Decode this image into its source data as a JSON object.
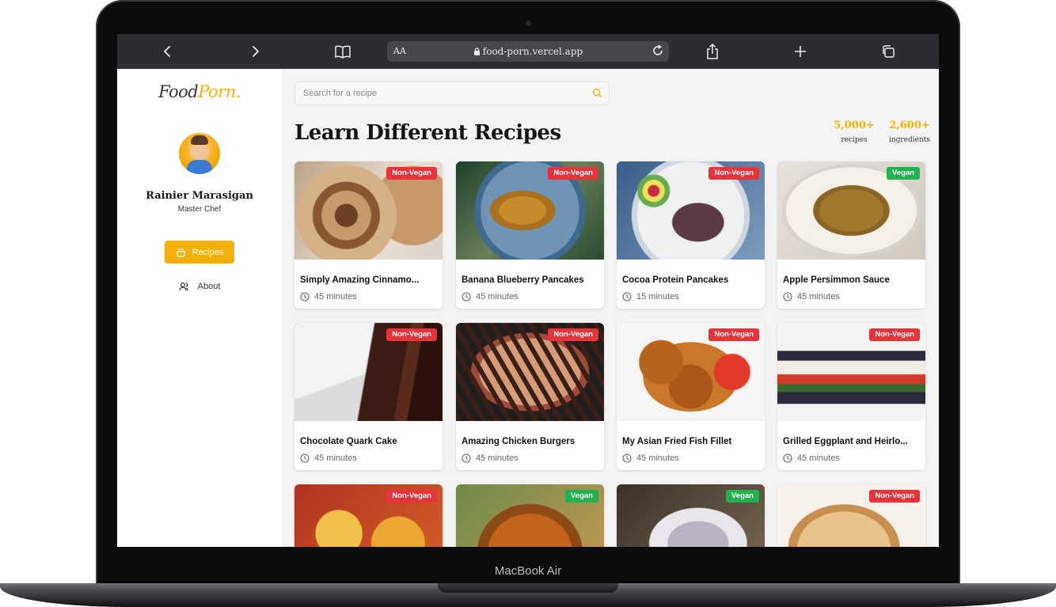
{
  "device": {
    "label": "MacBook Air"
  },
  "browser": {
    "aa_label": "AA",
    "url": "food-porn.vercel.app",
    "icons": [
      "back-icon",
      "forward-icon",
      "bookmarks-icon",
      "lock-icon",
      "reload-icon",
      "share-icon",
      "new-tab-icon",
      "tabs-icon"
    ]
  },
  "sidebar": {
    "logo_part1": "Food",
    "logo_part2": "Porn.",
    "user_name": "Rainier Marasigan",
    "user_role": "Master Chef",
    "nav": [
      {
        "label": "Recipes",
        "icon": "pot-icon",
        "active": true
      },
      {
        "label": "About",
        "icon": "users-icon",
        "active": false
      }
    ]
  },
  "main": {
    "search_placeholder": "Search for a recipe",
    "heading": "Learn Different Recipes",
    "stats": [
      {
        "value": "5,000+",
        "label": "recipes"
      },
      {
        "value": "2,600+",
        "label": "ingredients"
      }
    ],
    "recipes": [
      {
        "title": "Simply Amazing Cinnamo...",
        "time": "45 minutes",
        "badge": "Non-Vegan"
      },
      {
        "title": "Banana Blueberry Pancakes",
        "time": "45 minutes",
        "badge": "Non-Vegan"
      },
      {
        "title": "Cocoa Protein Pancakes",
        "time": "15 minutes",
        "badge": "Non-Vegan"
      },
      {
        "title": "Apple Persimmon Sauce",
        "time": "45 minutes",
        "badge": "Vegan"
      },
      {
        "title": "Chocolate Quark Cake",
        "time": "45 minutes",
        "badge": "Non-Vegan"
      },
      {
        "title": "Amazing Chicken Burgers",
        "time": "45 minutes",
        "badge": "Non-Vegan"
      },
      {
        "title": "My Asian Fried Fish Fillet",
        "time": "45 minutes",
        "badge": "Non-Vegan"
      },
      {
        "title": "Grilled Eggplant and Heirlo...",
        "time": "45 minutes",
        "badge": "Non-Vegan"
      },
      {
        "title": "",
        "time": "",
        "badge": "Non-Vegan"
      },
      {
        "title": "",
        "time": "",
        "badge": "Vegan"
      },
      {
        "title": "",
        "time": "",
        "badge": "Vegan"
      },
      {
        "title": "",
        "time": "",
        "badge": "Non-Vegan"
      }
    ]
  },
  "colors": {
    "accent": "#f2b10a",
    "non_vegan": "#e8333a",
    "vegan": "#22b14c"
  }
}
